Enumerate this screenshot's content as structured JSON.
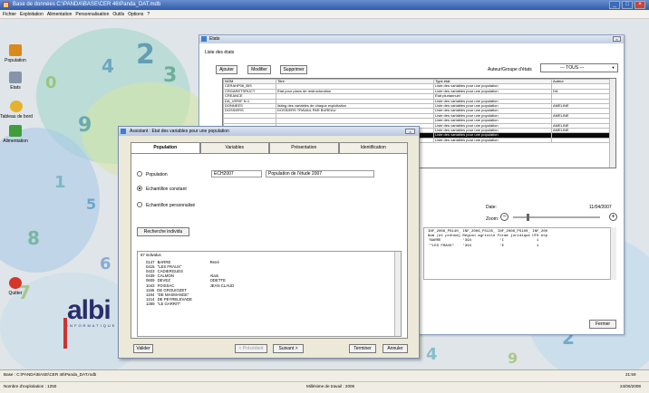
{
  "title": "Base de données C:\\PANDA\\BASE\\CER 46\\Panda_DAT.mdb",
  "menu": [
    "Fichier",
    "Exploitation",
    "Alimentation",
    "Personnalisation",
    "Outils",
    "Options",
    "?"
  ],
  "desktop_icons": [
    {
      "label": "Population",
      "color": "#d98a1a"
    },
    {
      "label": "Etats",
      "color": "#8794a8"
    },
    {
      "label": "Tableau de bord",
      "color": "#e5b32b"
    },
    {
      "label": "Alimentation",
      "color": "#3f9d3c"
    },
    {
      "label": "Quitter",
      "color": "#d6362a"
    }
  ],
  "logo": {
    "text": "albi",
    "sub": "INFORMATIQUE"
  },
  "etats_window": {
    "title": "Etats",
    "list_label": "Liste des états",
    "add": "Ajouter",
    "modify": "Modifier",
    "delete": "Supprimer",
    "author_group_label": "Auteur/Groupe d'états",
    "author_group_value": "--- TOUS ---",
    "columns": [
      "NOM",
      "Titre",
      "Type état",
      "Auteur"
    ],
    "rows": [
      [
        "CERAHP06_BIS",
        "",
        "Liste des variables pour une population",
        ""
      ],
      [
        "CRGARETSRUCT",
        "Etat pour plans de restructuration",
        "Liste des variables pour une population",
        "DA"
      ],
      [
        "CREANCE",
        "",
        "Etat pluriannuel",
        ""
      ],
      [
        "DA_VERIF N-1",
        "",
        "Liste des variables pour une population",
        ""
      ],
      [
        "DONNEES",
        "listing des variables de chaque exploitation",
        "Liste des variables pour une population",
        "AMELINE"
      ],
      [
        "DOSSIERS",
        "DOSSIERS TRAVAIL PAR BUREAU",
        "Liste des variables pour une population",
        ""
      ],
      [
        "",
        "",
        "Liste des variables pour une population",
        "AMELINE"
      ],
      [
        "",
        "",
        "Liste des variables pour une population",
        ""
      ],
      [
        "",
        "",
        "Liste des variables pour une population",
        "AMELINE"
      ],
      [
        "",
        "",
        "Liste des variables pour une population",
        "AMELINE"
      ],
      [
        "",
        "",
        "Liste des variables pour une population",
        ""
      ],
      [
        "",
        "",
        "Liste des variables pour une population",
        ""
      ]
    ],
    "date_label": "Date:",
    "date_value": "11/04/2007",
    "zoom_label": "Zoom:",
    "report_text": "INF_2006_PS140_ INF_2006_PS135_ INF_2006_PS100_ INF_200\nNom (et prénom) Région agricole Forme juridique UTH exp\n'BARRE          '394             'I               1\n'\"LES FRAUX\"    '394             'E               1",
    "close": "Fermer"
  },
  "assistant": {
    "title": "Assistant : Etat des variables pour une population",
    "tabs": [
      "Population",
      "Variables",
      "Présentation",
      "Identification"
    ],
    "population_label": "Population",
    "population_code": "ECH2007",
    "population_desc": "Population de l'étude 2007",
    "constant_sample": "Echantillon constant",
    "custom_sample": "Echantillon personnalisé",
    "search_button": "Recherche individu",
    "count_line": "67 individus",
    "individuals": [
      [
        "0147",
        "BARRE",
        "René"
      ],
      [
        "0415",
        "\"LES FRAUX\"",
        ""
      ],
      [
        "0423",
        "CADIERGUES",
        ""
      ],
      [
        "0439",
        "CALMON",
        "Alain"
      ],
      [
        "0609",
        "DEVEZ",
        "ODETTE"
      ],
      [
        "1043",
        "FOISSAC",
        "JEAN CLAUD"
      ],
      [
        "1156",
        "DE GROUIOZET",
        ""
      ],
      [
        "1194",
        "\"DE MASMANGE\"",
        ""
      ],
      [
        "1214",
        "DE PEYRELEVADE",
        ""
      ],
      [
        "1259",
        "\"LE GARRIT\"",
        ""
      ]
    ],
    "validate": "Valider",
    "previous": "< Précédent",
    "next": "Suivant >",
    "finish": "Terminer",
    "cancel": "Annuler"
  },
  "status": {
    "base": "Base : C:\\PANDA\\BASE\\CER 46\\Panda_DAT.mdb",
    "time": "21:59",
    "count": "Nombre d'exploitation : 1250",
    "millesime": "Millésime de travail : 2006",
    "date": "24/06/2008"
  }
}
